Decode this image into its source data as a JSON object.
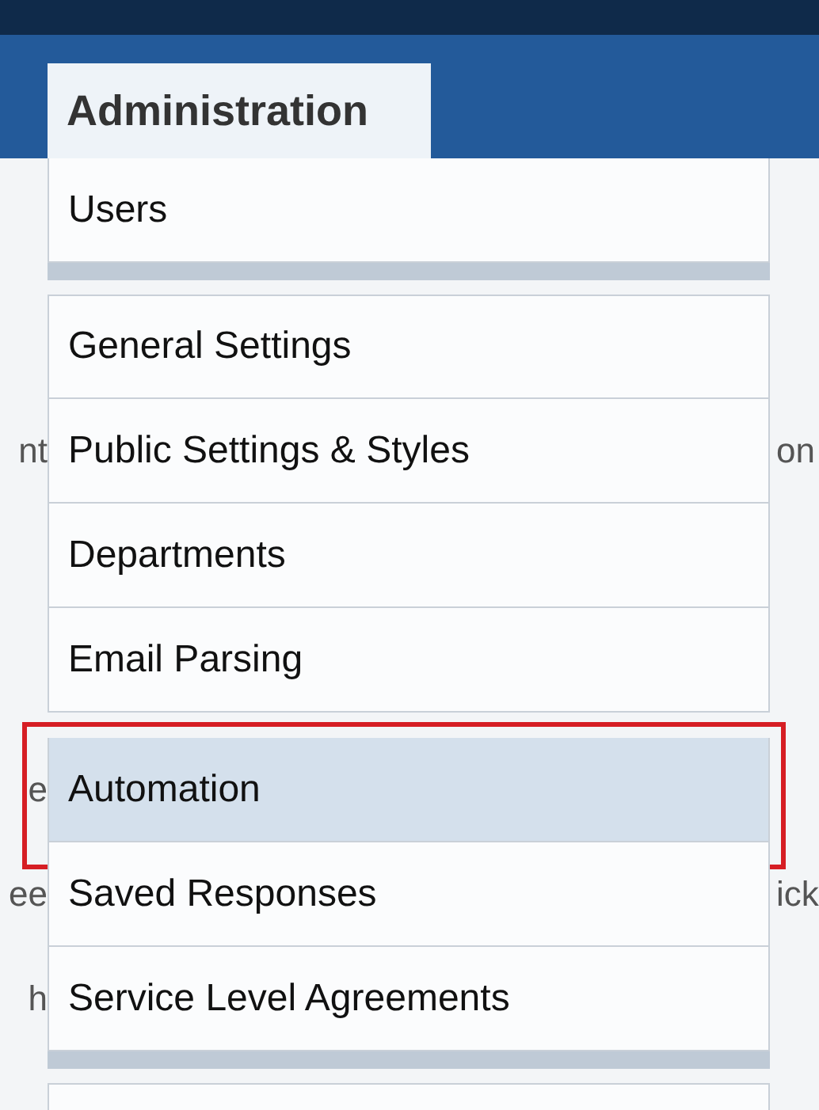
{
  "tab": {
    "label": "Administration",
    "selected": true
  },
  "menu_groups": [
    {
      "items": [
        {
          "label": "Users",
          "selected": false
        }
      ]
    },
    {
      "items": [
        {
          "label": "General Settings",
          "selected": false
        },
        {
          "label": "Public Settings & Styles",
          "selected": false,
          "left_fragment": "nt",
          "right_fragment": "on"
        },
        {
          "label": "Departments",
          "selected": false
        },
        {
          "label": "Email Parsing",
          "selected": false
        },
        {
          "label": "Automation",
          "selected": true,
          "highlighted": true,
          "left_fragment": "e"
        },
        {
          "label": "Saved Responses",
          "selected": false,
          "left_fragment": "ee",
          "right_fragment": "ick"
        },
        {
          "label": "Service Level Agreements",
          "selected": false,
          "left_fragment": "h"
        }
      ]
    }
  ]
}
